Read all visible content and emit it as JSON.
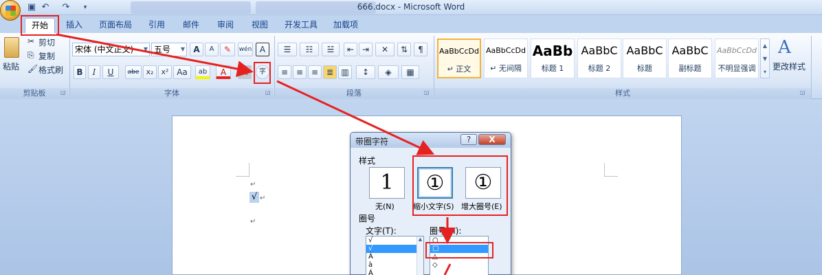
{
  "window": {
    "title": "666.docx - Microsoft Word"
  },
  "tabs": [
    {
      "label": "开始",
      "active": true
    },
    {
      "label": "插入"
    },
    {
      "label": "页面布局"
    },
    {
      "label": "引用"
    },
    {
      "label": "邮件"
    },
    {
      "label": "审阅"
    },
    {
      "label": "视图"
    },
    {
      "label": "开发工具"
    },
    {
      "label": "加载项"
    }
  ],
  "clipboard": {
    "paste_label": "粘贴",
    "cut_label": "剪切",
    "copy_label": "复制",
    "format_painter_label": "格式刷",
    "group_title": "剪贴板"
  },
  "font": {
    "font_name": "宋体 (中文正文)",
    "font_size": "五号",
    "grow_label": "A",
    "shrink_label": "A",
    "phonetic_label": "wén",
    "border_label": "A",
    "bold_label": "B",
    "italic_label": "I",
    "underline_label": "U",
    "strike_label": "abe",
    "subscript_label": "x₂",
    "superscript_label": "x²",
    "change_case_label": "Aa",
    "highlight_label": "ab",
    "color_label": "A",
    "shading_label": "A",
    "enclose_label": "字",
    "group_title": "字体"
  },
  "paragraph": {
    "group_title": "段落"
  },
  "styles": {
    "items": [
      {
        "sample": "AaBbCcDd",
        "name": "↵ 正文",
        "selected": true
      },
      {
        "sample": "AaBbCcDd",
        "name": "↵ 无间隔"
      },
      {
        "sample": "AaBb",
        "name": "标题 1"
      },
      {
        "sample": "AaBbC",
        "name": "标题 2"
      },
      {
        "sample": "AaBbC",
        "name": "标题"
      },
      {
        "sample": "AaBbC",
        "name": "副标题"
      },
      {
        "sample": "AaBbCcDd",
        "name": "不明显强调"
      }
    ],
    "change_styles_label": "更改样式",
    "group_title": "样式"
  },
  "document": {
    "paragraph_mark": "↵",
    "selected_char": "√"
  },
  "dialog": {
    "title": "带圈字符",
    "help_label": "?",
    "close_label": "X",
    "style_section": "样式",
    "options": [
      {
        "glyph": "1",
        "caption": "无(N)"
      },
      {
        "glyph": "①",
        "caption": "缩小文字(S)",
        "selected": true
      },
      {
        "glyph": "①",
        "caption": "增大圈号(E)"
      }
    ],
    "circle_section": "圈号",
    "text_label": "文字(T):",
    "enclosure_label": "圈号(H):",
    "text_items": [
      "√",
      "√",
      "À",
      "à",
      "Á"
    ],
    "enclosure_items": [
      "○",
      "□",
      "△",
      "◇"
    ]
  },
  "colors": {
    "annotation_red": "#e52222",
    "selection_blue": "#3399ff"
  }
}
